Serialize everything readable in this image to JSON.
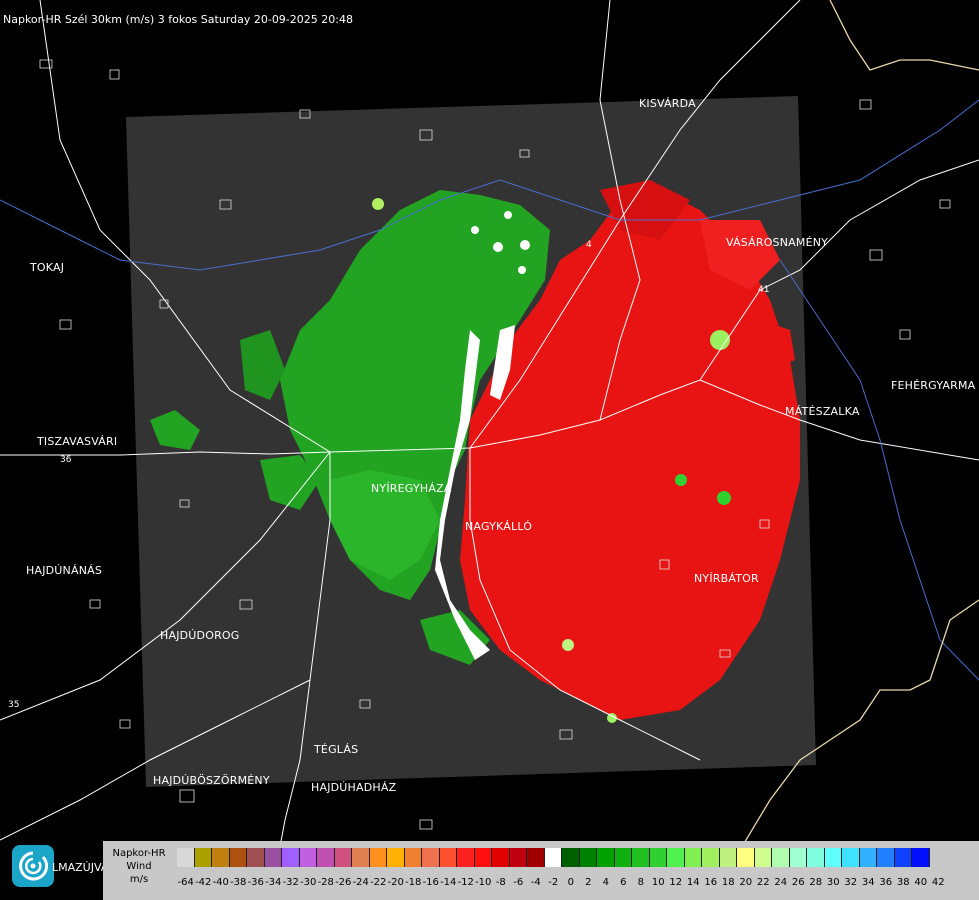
{
  "title": "Napkor-HR Szél 30km (m/s) 3 fokos Saturday 20-09-2025 20:48",
  "map": {
    "background_color": "#000000",
    "radar_area_color": "#333333",
    "approaching_color": "#1ea01e",
    "receding_color": "#e01010"
  },
  "cities": [
    "KISVÁRDA",
    "VÁSÁROSNAMÉNY",
    "TOKAJ",
    "FEHÉRGYARMA",
    "MÁTÉSZALKA",
    "TISZAVASVÁRI",
    "NYÍREGYHÁZA",
    "NYÍRBÁTOR",
    "HAJDÚNÁNÁS",
    "HAJDÚDOROG",
    "TÉGLÁS",
    "HAJDÚBÖSZÖRMÉNY",
    "HAJDÚHADHÁZ",
    "NAGYKÁLLÓ"
  ],
  "roads": [
    "4",
    "41",
    "36",
    "35"
  ],
  "logo": {
    "label": "LMAZÚJVÁR"
  },
  "legend": {
    "title_lines": [
      "Napkor-HR",
      "Wind",
      "m/s"
    ],
    "ticks": [
      "-64",
      "-42",
      "-40",
      "-38",
      "-36",
      "-34",
      "-32",
      "-30",
      "-28",
      "-26",
      "-24",
      "-22",
      "-20",
      "-18",
      "-16",
      "-14",
      "-12",
      "-10",
      "-8",
      "-6",
      "-4",
      "-2",
      "0",
      "2",
      "4",
      "6",
      "8",
      "10",
      "12",
      "14",
      "16",
      "18",
      "20",
      "22",
      "24",
      "26",
      "28",
      "30",
      "32",
      "34",
      "36",
      "38",
      "40",
      "42"
    ],
    "colors": [
      "#d8d8d8",
      "#aaa000",
      "#c08010",
      "#b05010",
      "#a05050",
      "#9a50a0",
      "#a060ff",
      "#c060e0",
      "#c050b0",
      "#d05080",
      "#e08050",
      "#ff9020",
      "#ffb000",
      "#f08030",
      "#f07050",
      "#ff5030",
      "#ff2020",
      "#ff1010",
      "#e00000",
      "#c00010",
      "#a00000",
      "#ffffff",
      "#006000",
      "#008000",
      "#00a000",
      "#10b010",
      "#20c020",
      "#30d030",
      "#50f050",
      "#80f050",
      "#a0f060",
      "#c0f080",
      "#ffff80",
      "#d0ff90",
      "#b0ffb0",
      "#a0ffd0",
      "#80ffe0",
      "#60ffff",
      "#40e0ff",
      "#30b0ff",
      "#2080ff",
      "#1040ff",
      "#0010ff"
    ]
  }
}
